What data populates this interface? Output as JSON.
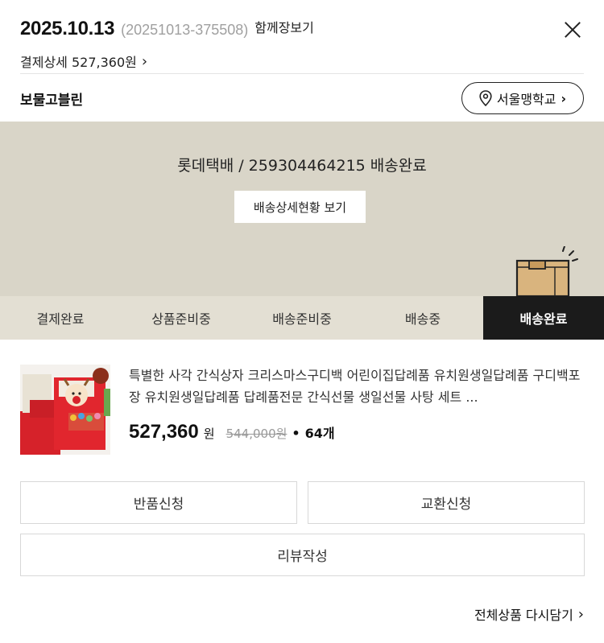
{
  "order": {
    "date": "2025.10.13",
    "order_number": "(20251013-375508)",
    "cart_link": "함께장보기",
    "payment_detail": "결제상세 527,360원"
  },
  "store": {
    "name": "보물고블린",
    "branch": "서울맹학교"
  },
  "delivery": {
    "tracking": "롯데택배 / 259304464215 배송완료",
    "track_button": "배송상세현황 보기",
    "steps": [
      {
        "label": "결제완료",
        "active": false
      },
      {
        "label": "상품준비중",
        "active": false
      },
      {
        "label": "배송준비중",
        "active": false
      },
      {
        "label": "배송중",
        "active": false
      },
      {
        "label": "배송완료",
        "active": true
      }
    ]
  },
  "product": {
    "title": "특별한 사각 간식상자 크리스마스구디백 어린이집답례품 유치원생일답례품 구디백포장 유치원생일답례품 답례품전문 간식선물 생일선물 사탕 세트 ...",
    "price": "527,360",
    "currency": "원",
    "original_price": "544,000원",
    "quantity": "64개",
    "separator": "•"
  },
  "actions": {
    "return": "반품신청",
    "exchange": "교환신청",
    "review": "리뷰작성",
    "reorder": "전체상품 다시담기"
  },
  "icons": {
    "close": "close-icon",
    "location": "location-pin-icon",
    "chevron": "chevron-right-icon",
    "box": "delivery-box-icon"
  },
  "colors": {
    "panel_bg": "#d9d5c8",
    "active_step_bg": "#1b1b1b",
    "box": "#d9b47e"
  }
}
